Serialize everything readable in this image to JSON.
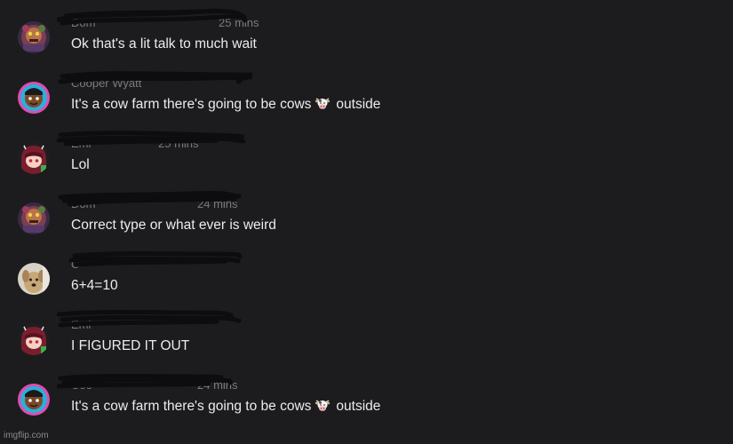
{
  "messages": [
    {
      "avatar": "animatronic-avatar-icon",
      "name": "Dom",
      "time": "25 mins",
      "text": "Ok that's a lit talk to much wait"
    },
    {
      "avatar": "cartoon-boy-avatar-icon",
      "name": "Cooper Wyatt",
      "time": "",
      "text_before": "It's a cow farm there's going to be cows",
      "emoji": "cow-face-icon",
      "text_after": "outside"
    },
    {
      "avatar": "gacha-character-avatar-icon",
      "name": "Emi",
      "time": "25 mins",
      "text": "Lol"
    },
    {
      "avatar": "animatronic-avatar-icon",
      "name": "Dom",
      "time": "24 mins",
      "text": "Correct type or what ever is weird"
    },
    {
      "avatar": "dog-photo-avatar-icon",
      "name": "C",
      "time": "",
      "text": "6+4=10"
    },
    {
      "avatar": "gacha-character-avatar-icon",
      "name": "Emi",
      "time": "",
      "text": "I FIGURED IT OUT"
    },
    {
      "avatar": "cartoon-boy-avatar-icon",
      "name": "Coo",
      "time": "24 mins",
      "text_before": "It's a cow farm there's going to be cows",
      "emoji": "cow-face-icon",
      "text_after": "outside"
    }
  ],
  "watermark": "imgflip.com"
}
